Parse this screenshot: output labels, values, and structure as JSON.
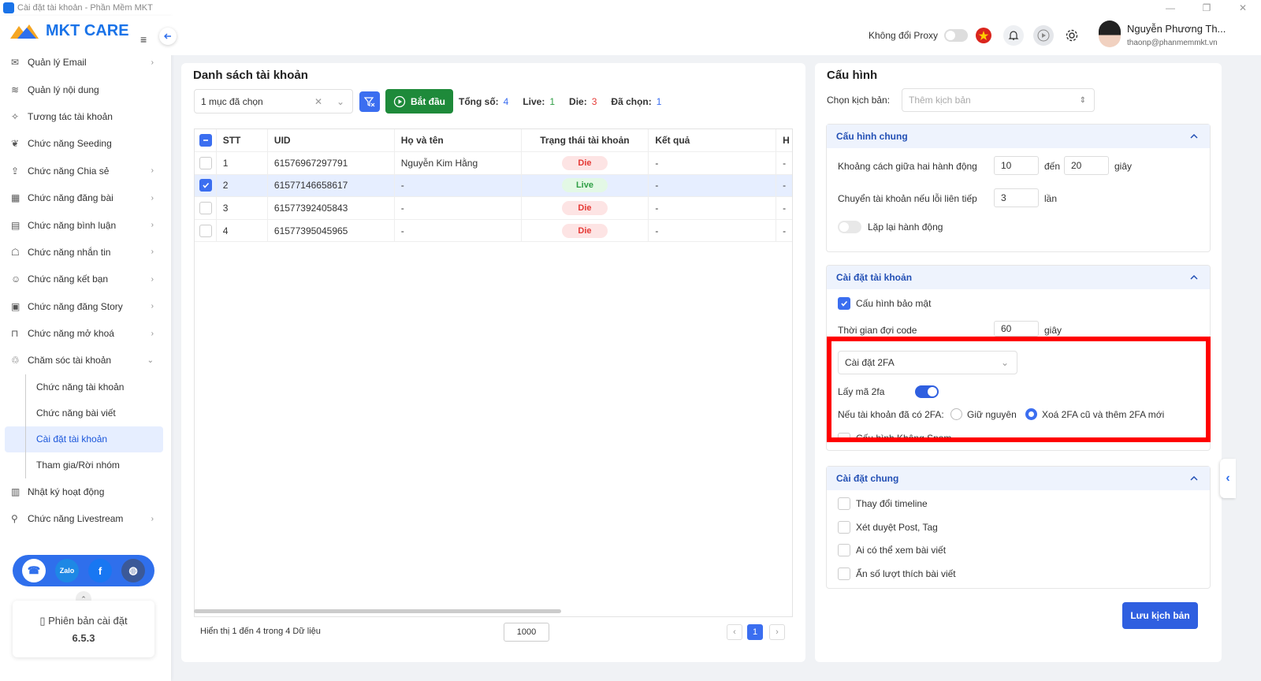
{
  "window": {
    "title": "Cài đặt tài khoản - Phần Mềm MKT"
  },
  "brand": {
    "name": "MKT CARE"
  },
  "sidebar": {
    "items": [
      {
        "label": "Quản lý Email",
        "icon": "email-gear-icon",
        "has_chevron": true
      },
      {
        "label": "Quản lý nội dung",
        "icon": "layers-icon",
        "has_chevron": false
      },
      {
        "label": "Tương tác tài khoản",
        "icon": "sparkle-icon",
        "has_chevron": false
      },
      {
        "label": "Chức năng Seeding",
        "icon": "seed-icon",
        "has_chevron": false
      },
      {
        "label": "Chức năng Chia sẻ",
        "icon": "share-icon",
        "has_chevron": true
      },
      {
        "label": "Chức năng đăng bài",
        "icon": "post-icon",
        "has_chevron": true
      },
      {
        "label": "Chức năng bình luận",
        "icon": "comment-icon",
        "has_chevron": true
      },
      {
        "label": "Chức năng nhắn tin",
        "icon": "chat-icon",
        "has_chevron": true
      },
      {
        "label": "Chức năng kết bạn",
        "icon": "add-friend-icon",
        "has_chevron": true
      },
      {
        "label": "Chức năng đăng Story",
        "icon": "story-icon",
        "has_chevron": true
      },
      {
        "label": "Chức năng mở khoá",
        "icon": "unlock-icon",
        "has_chevron": true
      },
      {
        "label": "Chăm sóc tài khoản",
        "icon": "care-icon",
        "has_chevron": true,
        "expanded": true
      }
    ],
    "subitems": [
      {
        "label": "Chức năng tài khoản",
        "active": false
      },
      {
        "label": "Chức năng bài viết",
        "active": false
      },
      {
        "label": "Cài đặt tài khoản",
        "active": true
      },
      {
        "label": "Tham gia/Rời nhóm",
        "active": false
      }
    ],
    "bottom_items": [
      {
        "label": "Nhật ký hoạt động",
        "icon": "log-icon",
        "has_chevron": false
      },
      {
        "label": "Chức năng Livestream",
        "icon": "livestream-icon",
        "has_chevron": true
      }
    ],
    "version": {
      "label": "Phiên bản cài đặt",
      "number": "6.5.3"
    }
  },
  "header": {
    "proxy_label": "Không đổi Proxy",
    "proxy_on": false,
    "user_name": "Nguyễn Phương Th...",
    "user_email": "thaonp@phanmemmkt.vn"
  },
  "accounts": {
    "title": "Danh sách tài khoản",
    "selection": "1 mục đã chọn",
    "start_label": "Bắt đầu",
    "stats": [
      {
        "label": "Tổng số:",
        "value": "4",
        "color": "#3b6ef0"
      },
      {
        "label": "Live:",
        "value": "1",
        "color": "#2e9e44"
      },
      {
        "label": "Die:",
        "value": "3",
        "color": "#e53935"
      },
      {
        "label": "Đã chọn:",
        "value": "1",
        "color": "#3b6ef0"
      }
    ],
    "columns": [
      "STT",
      "UID",
      "Họ và tên",
      "Trạng thái tài khoản",
      "Kết quả",
      "H"
    ],
    "rows": [
      {
        "stt": "1",
        "uid": "61576967297791",
        "name": "Nguyễn Kim Hằng",
        "status": "Die",
        "result": "-",
        "extra": "-",
        "checked": false
      },
      {
        "stt": "2",
        "uid": "61577146658617",
        "name": "-",
        "status": "Live",
        "result": "-",
        "extra": "-",
        "checked": true
      },
      {
        "stt": "3",
        "uid": "61577392405843",
        "name": "-",
        "status": "Die",
        "result": "-",
        "extra": "-",
        "checked": false
      },
      {
        "stt": "4",
        "uid": "61577395045965",
        "name": "-",
        "status": "Die",
        "result": "-",
        "extra": "-",
        "checked": false
      }
    ],
    "footer_info": "Hiển thị 1 đến 4 trong 4 Dữ liệu",
    "page_size": "1000",
    "current_page": "1"
  },
  "config": {
    "title": "Cấu hình",
    "script_label": "Chọn kịch bản:",
    "script_placeholder": "Thêm kịch bản",
    "general": {
      "title": "Cấu hình chung",
      "delay_label": "Khoảng cách giữa hai hành động",
      "delay_from": "10",
      "delay_to_label": "đến",
      "delay_to": "20",
      "delay_unit": "giây",
      "switch_label": "Chuyển tài khoản nếu lỗi liên tiếp",
      "switch_value": "3",
      "switch_unit": "lần",
      "repeat_label": "Lặp lại hành động",
      "repeat_on": false
    },
    "account": {
      "title": "Cài đặt tài khoản",
      "security_label": "Cấu hình bảo mật",
      "security_checked": true,
      "wait_label": "Thời gian đợi code",
      "wait_value": "60",
      "wait_unit": "giây",
      "twofa_select": "Cài đặt 2FA",
      "get2fa_label": "Lấy mã 2fa",
      "get2fa_on": true,
      "existing_label": "Nếu tài khoản đã có 2FA:",
      "opt_keep": "Giữ nguyên",
      "opt_replace": "Xoá 2FA cũ và thêm 2FA mới",
      "selected": "replace",
      "spam_label": "Cấu hình Không Spam"
    },
    "common": {
      "title": "Cài đặt chung",
      "options": [
        {
          "label": "Thay đổi timeline",
          "checked": false
        },
        {
          "label": "Xét duyệt Post, Tag",
          "checked": false
        },
        {
          "label": "Ai có thể xem bài viết",
          "checked": false
        },
        {
          "label": "Ẩn số lượt thích bài viết",
          "checked": false
        }
      ]
    },
    "save_label": "Lưu kịch bản"
  },
  "colors": {
    "primary": "#3b6ef0",
    "start_green": "#1e8a3a",
    "highlight_red": "#ff0000"
  }
}
